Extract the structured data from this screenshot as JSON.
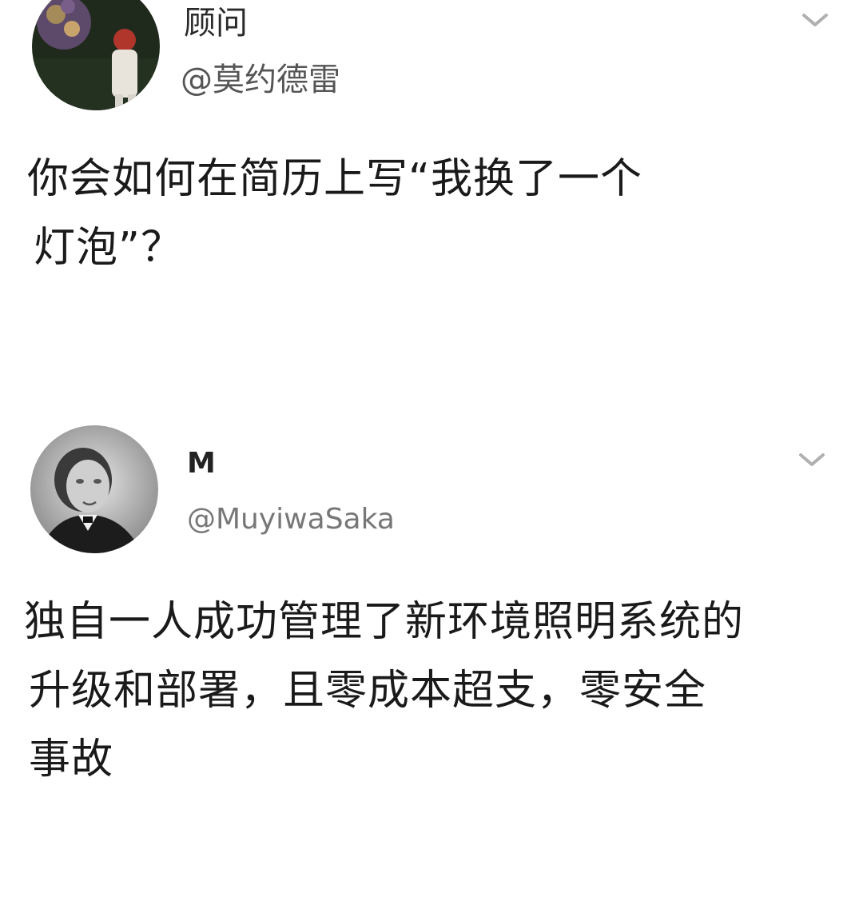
{
  "tweets": [
    {
      "display_name": "顾问",
      "handle": "@莫约德雷",
      "avatar_icon": "avatar-photo-bouquet",
      "menu_icon": "chevron-down-icon",
      "text_lines": [
        "你会如何在简历上写“我换了一个",
        "灯泡”？"
      ]
    },
    {
      "display_name": "M",
      "handle": "@MuyiwaSaka",
      "avatar_icon": "avatar-photo-portrait",
      "menu_icon": "chevron-down-icon",
      "text_lines": [
        "独自一人成功管理了新环境照明系统的",
        "升级和部署，且零成本超支，零安全",
        "事故"
      ]
    }
  ],
  "colors": {
    "background": "#ffffff",
    "text": "#1a1a1a",
    "handle": "#666666",
    "chevron": "#b0b0b0"
  }
}
